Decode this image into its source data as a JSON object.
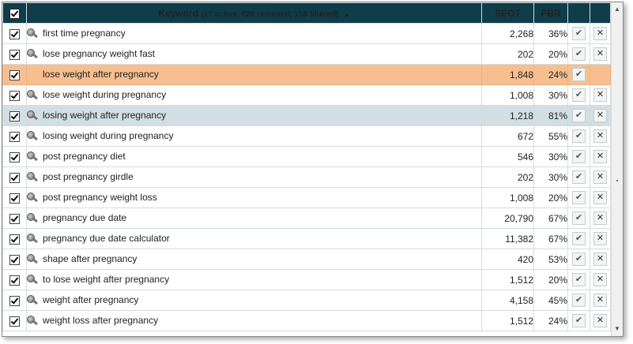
{
  "header": {
    "keyword_label": "Keyword",
    "keyword_summary": "(17 active, 626 removed, 158 filtered)",
    "sort_indicator": "▲",
    "seot_label": "SEOT",
    "pbr_label": "PBR"
  },
  "icons": {
    "accept": "✔",
    "remove": "✕"
  },
  "rows": [
    {
      "keyword": "first time pregnancy",
      "seot": "2,268",
      "pbr": "36%"
    },
    {
      "keyword": "lose pregnancy weight fast",
      "seot": "202",
      "pbr": "20%"
    },
    {
      "keyword": "lose weight after pregnancy",
      "seot": "1,848",
      "pbr": "24%"
    },
    {
      "keyword": "lose weight during pregnancy",
      "seot": "1,008",
      "pbr": "30%"
    },
    {
      "keyword": "losing weight after pregnancy",
      "seot": "1,218",
      "pbr": "81%"
    },
    {
      "keyword": "losing weight during pregnancy",
      "seot": "672",
      "pbr": "55%"
    },
    {
      "keyword": "post pregnancy diet",
      "seot": "546",
      "pbr": "30%"
    },
    {
      "keyword": "post pregnancy girdle",
      "seot": "202",
      "pbr": "30%"
    },
    {
      "keyword": "post pregnancy weight loss",
      "seot": "1,008",
      "pbr": "20%"
    },
    {
      "keyword": "pregnancy due date",
      "seot": "20,790",
      "pbr": "67%"
    },
    {
      "keyword": "pregnancy due date calculator",
      "seot": "11,382",
      "pbr": "67%"
    },
    {
      "keyword": "shape after pregnancy",
      "seot": "420",
      "pbr": "53%"
    },
    {
      "keyword": "to lose weight after pregnancy",
      "seot": "1,512",
      "pbr": "20%"
    },
    {
      "keyword": "weight after pregnancy",
      "seot": "4,158",
      "pbr": "45%"
    },
    {
      "keyword": "weight loss after pregnancy",
      "seot": "1,512",
      "pbr": "24%"
    }
  ],
  "scrollbar": {
    "up": "▲",
    "down": "▼"
  },
  "colors": {
    "header_bg": "#0f3d4a",
    "highlight_orange": "#f7bf8f",
    "highlight_blue": "#d1dee3"
  }
}
